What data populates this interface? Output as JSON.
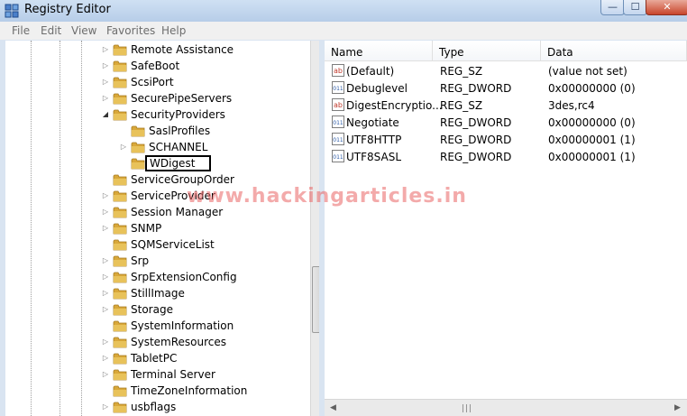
{
  "window": {
    "title": "Registry Editor",
    "controls": {
      "minimize": "—",
      "maximize": "☐",
      "close": "✕"
    }
  },
  "menu": [
    "File",
    "Edit",
    "View",
    "Favorites",
    "Help"
  ],
  "tree": {
    "items": [
      {
        "label": "Remote Assistance",
        "level": 1,
        "expander": "collapsed"
      },
      {
        "label": "SafeBoot",
        "level": 1,
        "expander": "collapsed"
      },
      {
        "label": "ScsiPort",
        "level": 1,
        "expander": "collapsed"
      },
      {
        "label": "SecurePipeServers",
        "level": 1,
        "expander": "collapsed"
      },
      {
        "label": "SecurityProviders",
        "level": 1,
        "expander": "expanded"
      },
      {
        "label": "SaslProfiles",
        "level": 2,
        "expander": "none"
      },
      {
        "label": "SCHANNEL",
        "level": 2,
        "expander": "collapsed"
      },
      {
        "label": "WDigest",
        "level": 2,
        "expander": "none",
        "selected": true
      },
      {
        "label": "ServiceGroupOrder",
        "level": 1,
        "expander": "none"
      },
      {
        "label": "ServiceProvider",
        "level": 1,
        "expander": "collapsed"
      },
      {
        "label": "Session Manager",
        "level": 1,
        "expander": "collapsed"
      },
      {
        "label": "SNMP",
        "level": 1,
        "expander": "collapsed"
      },
      {
        "label": "SQMServiceList",
        "level": 1,
        "expander": "none"
      },
      {
        "label": "Srp",
        "level": 1,
        "expander": "collapsed"
      },
      {
        "label": "SrpExtensionConfig",
        "level": 1,
        "expander": "collapsed"
      },
      {
        "label": "StillImage",
        "level": 1,
        "expander": "collapsed"
      },
      {
        "label": "Storage",
        "level": 1,
        "expander": "collapsed"
      },
      {
        "label": "SystemInformation",
        "level": 1,
        "expander": "none"
      },
      {
        "label": "SystemResources",
        "level": 1,
        "expander": "collapsed"
      },
      {
        "label": "TabletPC",
        "level": 1,
        "expander": "collapsed"
      },
      {
        "label": "Terminal Server",
        "level": 1,
        "expander": "collapsed"
      },
      {
        "label": "TimeZoneInformation",
        "level": 1,
        "expander": "none"
      },
      {
        "label": "usbflags",
        "level": 1,
        "expander": "collapsed"
      }
    ]
  },
  "values_list": {
    "columns": [
      "Name",
      "Type",
      "Data"
    ],
    "rows": [
      {
        "icon": "string-value-icon",
        "name": "(Default)",
        "type": "REG_SZ",
        "data": "(value not set)"
      },
      {
        "icon": "binary-value-icon",
        "name": "Debuglevel",
        "type": "REG_DWORD",
        "data": "0x00000000 (0)"
      },
      {
        "icon": "string-value-icon",
        "name": "DigestEncryptio...",
        "type": "REG_SZ",
        "data": "3des,rc4"
      },
      {
        "icon": "binary-value-icon",
        "name": "Negotiate",
        "type": "REG_DWORD",
        "data": "0x00000000 (0)"
      },
      {
        "icon": "binary-value-icon",
        "name": "UTF8HTTP",
        "type": "REG_DWORD",
        "data": "0x00000001 (1)"
      },
      {
        "icon": "binary-value-icon",
        "name": "UTF8SASL",
        "type": "REG_DWORD",
        "data": "0x00000001 (1)"
      }
    ]
  },
  "watermark": "www.hackingarticles.in",
  "colors": {
    "folder": "#e8c25a",
    "accent": "#2b5aa7",
    "selection_border": "#000000"
  }
}
